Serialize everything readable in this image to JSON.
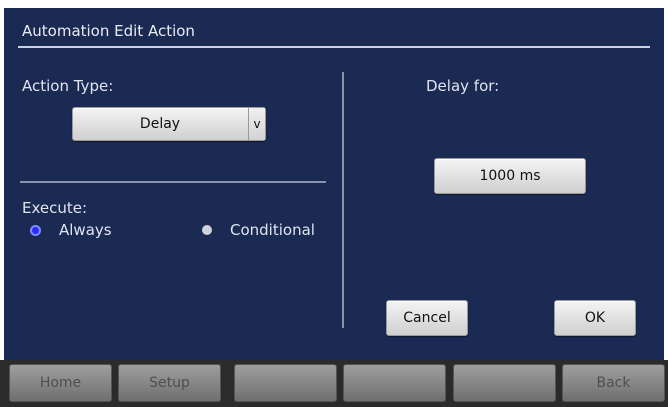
{
  "window": {
    "title": "Automation Edit Action"
  },
  "action": {
    "type_label": "Action Type:",
    "type_value": "Delay",
    "dropdown_arrow": "v"
  },
  "execute": {
    "label": "Execute:",
    "options": [
      {
        "label": "Always",
        "selected": true
      },
      {
        "label": "Conditional",
        "selected": false
      }
    ]
  },
  "delay": {
    "label": "Delay for:",
    "value": "1000 ms"
  },
  "dialog_buttons": {
    "cancel": "Cancel",
    "ok": "OK"
  },
  "nav": {
    "buttons": [
      "Home",
      "Setup",
      "",
      "",
      "",
      "Back"
    ]
  },
  "colors": {
    "panel_bg": "#1b2a52",
    "radio_selected": "#2a2aff",
    "nav_bg": "#2b2b2b"
  }
}
